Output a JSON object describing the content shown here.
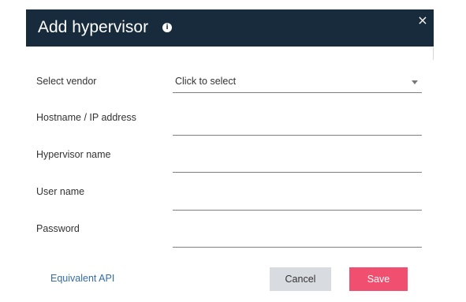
{
  "dialog": {
    "title": "Add hypervisor",
    "info_icon": "info-icon",
    "close_icon": "close-icon",
    "colors": {
      "header": "#172b3d",
      "save_button": "#f04f70",
      "cancel_button": "#d8dbe0",
      "link": "#356ca8"
    }
  },
  "form": {
    "vendor": {
      "label": "Select vendor",
      "value": "Click to select",
      "icon": "chevron-down-icon"
    },
    "hostname": {
      "label": "Hostname / IP address",
      "value": ""
    },
    "hypervisor_name": {
      "label": "Hypervisor name",
      "value": ""
    },
    "user_name": {
      "label": "User name",
      "value": ""
    },
    "password": {
      "label": "Password",
      "value": ""
    }
  },
  "footer": {
    "api_link": "Equivalent API",
    "cancel_label": "Cancel",
    "save_label": "Save"
  }
}
